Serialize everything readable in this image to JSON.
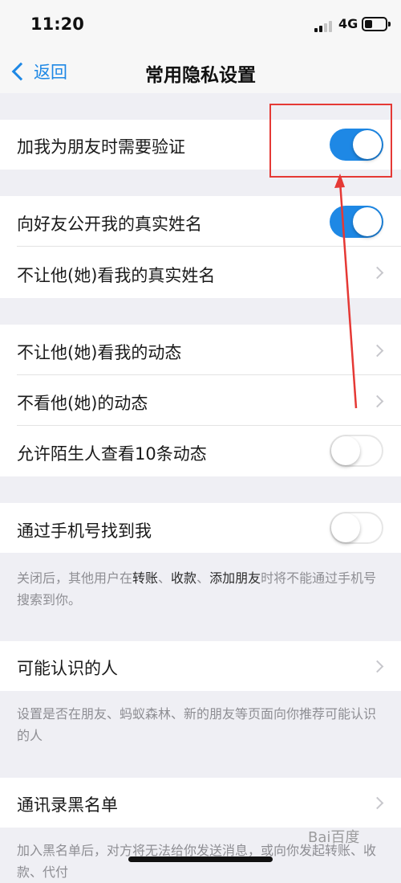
{
  "status": {
    "time": "11:20",
    "network": "4G"
  },
  "nav": {
    "back_label": "返回",
    "title": "常用隐私设置"
  },
  "rows": {
    "verify": {
      "label": "加我为朋友时需要验证",
      "toggle": "on"
    },
    "real_name": {
      "label": "向好友公开我的真实姓名",
      "toggle": "on"
    },
    "hide_real_name": {
      "label": "不让他(她)看我的真实姓名"
    },
    "hide_my_moments": {
      "label": "不让他(她)看我的动态"
    },
    "not_see_moments": {
      "label": "不看他(她)的动态"
    },
    "stranger_moments": {
      "label": "允许陌生人查看10条动态",
      "toggle": "off"
    },
    "find_by_phone": {
      "label": "通过手机号找到我",
      "toggle": "off"
    },
    "may_know": {
      "label": "可能认识的人"
    },
    "contacts_blacklist": {
      "label": "通讯录黑名单"
    }
  },
  "descriptions": {
    "phone": {
      "part1": "关闭后，其他用户在",
      "bold1": "转账",
      "sep1": "、",
      "bold2": "收款",
      "sep2": "、",
      "bold3": "添加朋友",
      "part2": "时将不能通过手机号搜索到你。"
    },
    "may_know": "设置是否在朋友、蚂蚁森林、新的朋友等页面向你推荐可能认识的人",
    "blacklist": "加入黑名单后，对方将无法给你发送消息，或向你发起转账、收款、代付"
  },
  "watermark": "Bai百度",
  "colors": {
    "accent": "#1e88e5",
    "annotation": "#e53935",
    "background": "#efeff4"
  }
}
